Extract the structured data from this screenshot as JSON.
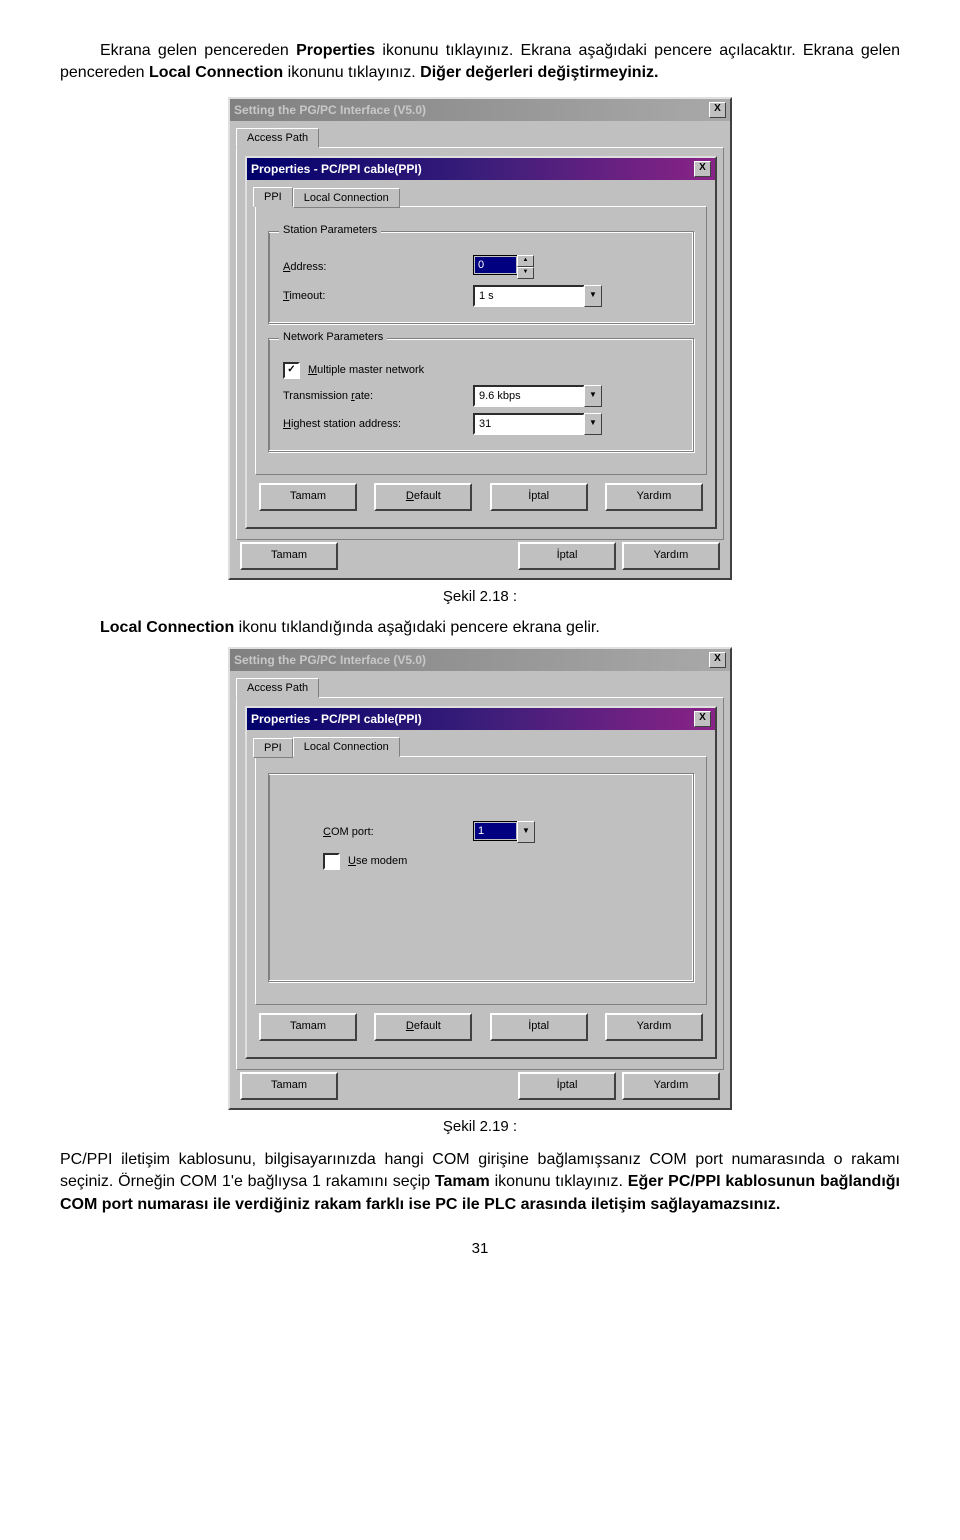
{
  "intro": {
    "p1a": "Ekrana gelen pencereden ",
    "p1b": "Properties",
    "p1c": " ikonunu tıklayınız. Ekrana aşağıdaki pencere açılacaktır. Ekrana gelen pencereden ",
    "p1d": "Local Connection",
    "p1e": "  ikonunu tıklayınız. ",
    "p1f": "Diğer değerleri değiştirmeyiniz."
  },
  "outerDialog": {
    "title": "Setting the PG/PC Interface (V5.0)",
    "closeX": "X",
    "tabAccessPath": "Access Path",
    "btnTamam": "Tamam",
    "btnIptal": "İptal",
    "btnYardim": "Yardım"
  },
  "innerDialog": {
    "title": "Properties - PC/PPI cable(PPI)",
    "tabPPI": "PPI",
    "tabLocalConn": "Local Connection",
    "group1": "Station Parameters",
    "lblAddress": "Address:",
    "valAddress": "0",
    "lblTimeout": "Timeout:",
    "valTimeout": "1 s",
    "group2": "Network Parameters",
    "lblMultiple": "Multiple master network",
    "chkMultiple": "✓",
    "lblTransRate": "Transmission rate:",
    "valTransRate": "9.6 kbps",
    "lblHighest": "Highest station address:",
    "valHighest": "31",
    "btnTamam": "Tamam",
    "btnDefault": "Default",
    "btnIptal": "İptal",
    "btnYardim": "Yardım"
  },
  "figcap1": "Şekil 2.18 :",
  "middle": {
    "p1a": "Local Connection",
    "p1b": " ikonu tıklandığında aşağıdaki pencere ekrana gelir."
  },
  "innerDialog2": {
    "lblComPort": "COM port:",
    "valComPort": "1",
    "lblUseModem": "Use modem"
  },
  "figcap2": "Şekil 2.19 :",
  "outro": {
    "p1a": "PC/PPI  iletişim kablosunu, bilgisayarınızda hangi COM girişine bağlamışsanız COM port numarasında  o rakamı seçiniz. Örneğin COM 1'e bağlıysa 1 rakamını seçip ",
    "p1b": "Tamam",
    "p1c": " ikonunu tıklayınız. ",
    "p1d": "Eğer PC/PPI kablosunun bağlandığı COM port numarası ile verdiğiniz rakam farklı ise PC ile PLC arasında iletişim sağlayamazsınız."
  },
  "pagenum": "31"
}
